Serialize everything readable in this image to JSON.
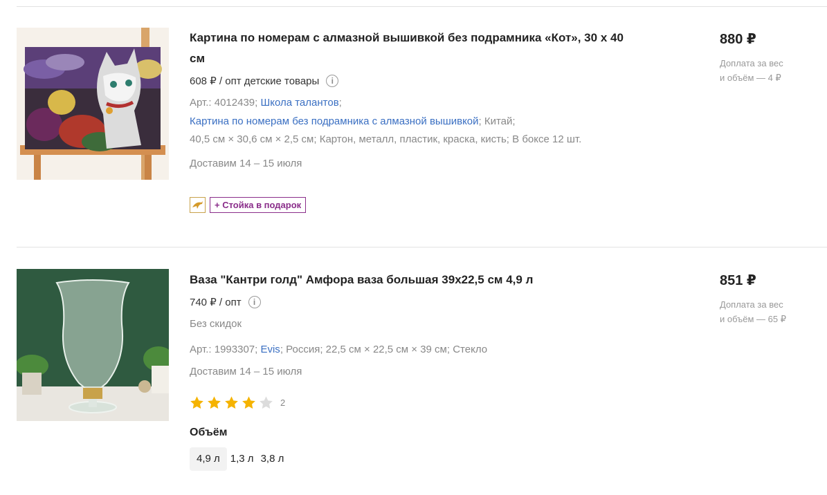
{
  "products": [
    {
      "title_line1": "Картина по номерам с алмазной вышивкой без подрамника «Кот», 30 х 40",
      "title_line2": "см",
      "opt_price": "608 ₽ / опт детские товары",
      "article": "Арт.: 4012439;",
      "brand": "Школа талантов",
      "sep": ";",
      "category_link": "Картина по номерам без подрамника с алмазной вышивкой",
      "country": "; Китай;",
      "specs": "40,5 см × 30,6 см × 2,5 см; Картон, металл, пластик, краска, кисть; В боксе 12 шт.",
      "delivery": "Доставим 14 – 15 июля",
      "price": "880 ₽",
      "surcharge_line1": "Доплата за вес",
      "surcharge_line2": "и объём — 4 ₽",
      "badge_icon": "dolphin-icon",
      "gift_badge": "+ Стойка в подарок"
    },
    {
      "title": "Ваза \"Кантри голд\" Амфора ваза большая 39х22,5 см 4,9 л",
      "opt_price": "740 ₽ / опт",
      "discount": "Без скидок",
      "article": "Арт.: 1993307;",
      "brand": "Evis",
      "specs": "; Россия; 22,5 см × 22,5 см × 39 см; Стекло",
      "delivery": "Доставим 14 – 15 июля",
      "price": "851 ₽",
      "surcharge_line1": "Доплата за вес",
      "surcharge_line2": "и объём — 65 ₽",
      "rating": 4,
      "rating_max": 5,
      "rating_count": "2",
      "variants_title": "Объём",
      "variants": [
        "4,9 л",
        "1,3 л",
        "3,8 л"
      ]
    }
  ],
  "info_icon": "info-icon",
  "colors": {
    "link": "#3a6fc2",
    "star": "#f5b301",
    "star_empty": "#dcdcdc",
    "gift": "#8a2d8a"
  }
}
